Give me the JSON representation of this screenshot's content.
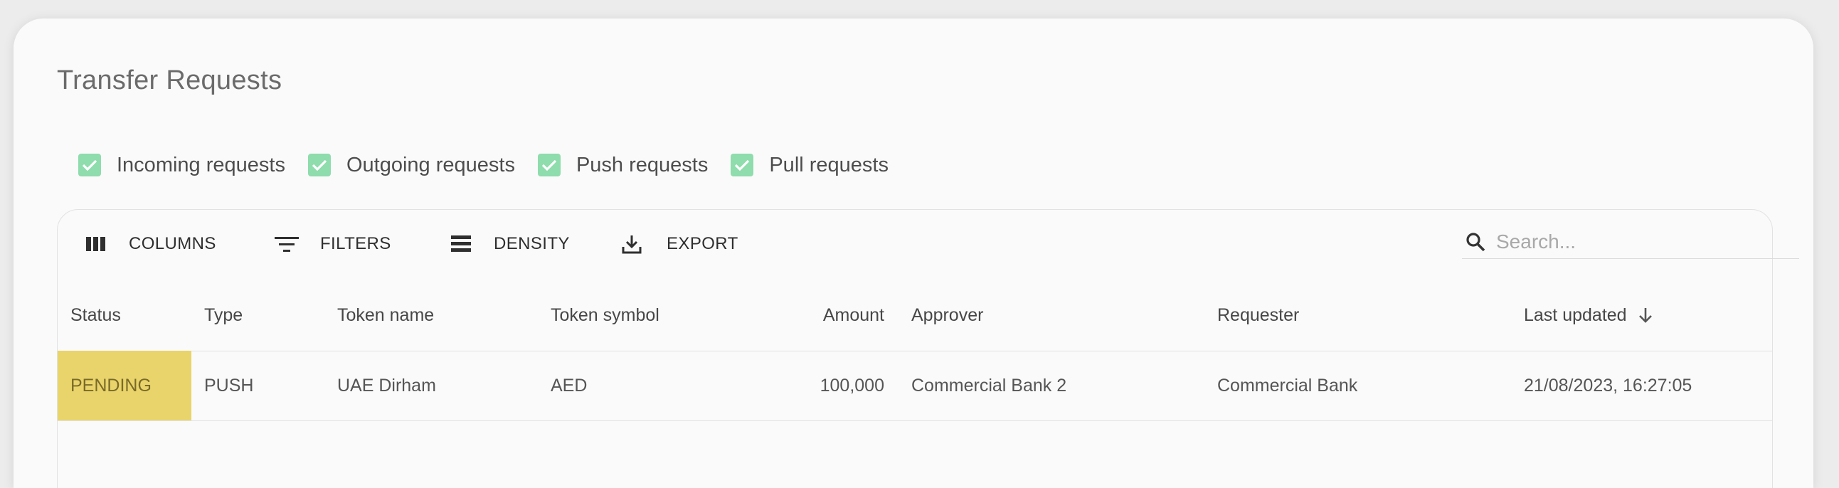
{
  "page": {
    "title": "Transfer Requests"
  },
  "filters": [
    {
      "label": "Incoming requests",
      "checked": true
    },
    {
      "label": "Outgoing requests",
      "checked": true
    },
    {
      "label": "Push requests",
      "checked": true
    },
    {
      "label": "Pull requests",
      "checked": true
    }
  ],
  "toolbar": {
    "columns_label": "COLUMNS",
    "filters_label": "FILTERS",
    "density_label": "DENSITY",
    "export_label": "EXPORT"
  },
  "search": {
    "placeholder": "Search...",
    "value": ""
  },
  "table": {
    "columns": [
      "Status",
      "Type",
      "Token name",
      "Token symbol",
      "Amount",
      "Approver",
      "Requester",
      "Last updated"
    ],
    "sort": {
      "column": "Last updated",
      "direction": "descending"
    },
    "rows": [
      {
        "status": "PENDING",
        "type": "PUSH",
        "token_name": "UAE Dirham",
        "token_symbol": "AED",
        "amount": "100,000",
        "approver": "Commercial Bank 2",
        "requester": "Commercial Bank",
        "last_updated": "21/08/2023, 16:27:05"
      }
    ]
  },
  "colors": {
    "checkbox": "#8fdcad",
    "status_pending": "#e8d46a"
  },
  "icons": {
    "columns": "view-column-icon",
    "filters": "filter-list-icon",
    "density": "density-icon",
    "export": "download-icon",
    "search": "search-icon",
    "sort": "arrow-down-icon",
    "check": "check-icon"
  }
}
